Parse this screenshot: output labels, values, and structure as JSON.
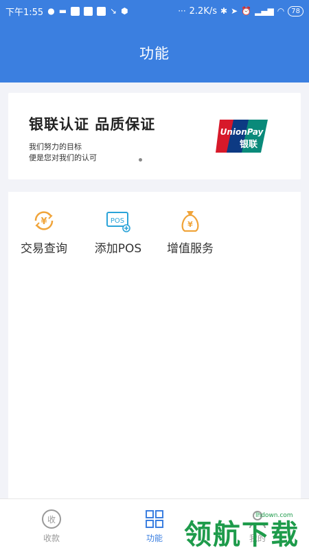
{
  "status_bar": {
    "time": "下午1:55",
    "network_speed": "2.2K/s",
    "battery": "78"
  },
  "header": {
    "title": "功能"
  },
  "banner": {
    "title": "银联认证  品质保证",
    "subtitle_line1": "我们努力的目标",
    "subtitle_line2": "便是您对我们的认可",
    "logo_text_en": "UnionPay",
    "logo_text_cn": "银联"
  },
  "functions": [
    {
      "label": "交易查询",
      "icon": "yuan-exchange-icon"
    },
    {
      "label": "添加POS",
      "icon": "pos-add-icon"
    },
    {
      "label": "增值服务",
      "icon": "money-bag-icon"
    }
  ],
  "tabs": [
    {
      "label": "收款",
      "icon": "collect-icon",
      "active": false
    },
    {
      "label": "功能",
      "icon": "grid-icon",
      "active": true
    },
    {
      "label": "我的",
      "icon": "user-icon",
      "active": false
    }
  ],
  "watermark": {
    "text": "领航下载",
    "url": "lhdown.com"
  },
  "colors": {
    "primary": "#3b7fe0",
    "accent_orange": "#f0a43a",
    "accent_cyan": "#2aa3d8",
    "watermark_green": "#1e9b4b"
  }
}
